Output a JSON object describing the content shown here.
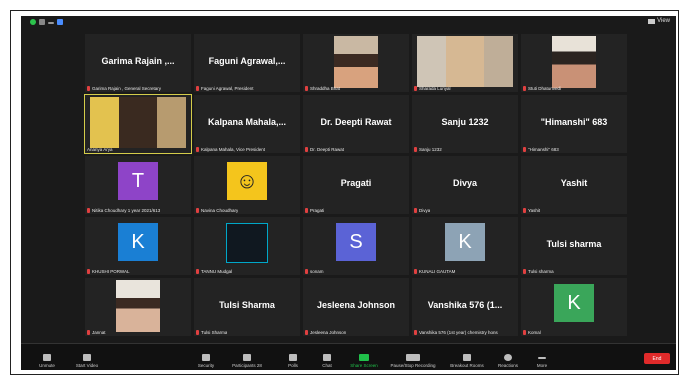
{
  "topbar": {
    "view_label": "View"
  },
  "tiles": [
    {
      "kind": "name",
      "big": "Garima Rajain ,...",
      "label": "Garima Rajain , General Secretary"
    },
    {
      "kind": "name",
      "big": "Faguni Agrawal,...",
      "label": "Faguni Agrawal, President"
    },
    {
      "kind": "photo",
      "label": "Shraddha Bhat"
    },
    {
      "kind": "photo",
      "label": "Sharada Lunyal"
    },
    {
      "kind": "photo",
      "label": "Stuti Dhatunvedi"
    },
    {
      "kind": "photo",
      "label": "Ananya Arya"
    },
    {
      "kind": "name",
      "big": "Kalpana Mahala,...",
      "label": "Kalpana Mahala, Vice President"
    },
    {
      "kind": "name",
      "big": "Dr. Deepti Rawat",
      "label": "Dr. Deepti Rawat"
    },
    {
      "kind": "name",
      "big": "Sanju 1232",
      "label": "Sanju 1232"
    },
    {
      "kind": "name",
      "big": "\"Himanshi\" 683",
      "label": "\"Himanshi\" 683"
    },
    {
      "kind": "avatar",
      "letter": "T",
      "color": "#8e44c8",
      "label": "Nitika Choudhary 1 year 2021/613"
    },
    {
      "kind": "smiley",
      "label": "Navina Choudhary"
    },
    {
      "kind": "name",
      "big": "Pragati",
      "label": "Pragati"
    },
    {
      "kind": "name",
      "big": "Divya",
      "label": "Divya"
    },
    {
      "kind": "name",
      "big": "Yashit",
      "label": "Yashit"
    },
    {
      "kind": "avatar",
      "letter": "K",
      "color": "#1a7fd4",
      "label": "KHUSHI PORWAL"
    },
    {
      "kind": "logo",
      "label": "TANNU Mudgal"
    },
    {
      "kind": "avatar",
      "letter": "S",
      "color": "#5b63d6",
      "label": "sonam"
    },
    {
      "kind": "avatar",
      "letter": "K",
      "color": "#8da3b5",
      "label": "KUNALI GAUTAM"
    },
    {
      "kind": "name",
      "big": "Tulsi sharma",
      "label": "Tulsi sharma"
    },
    {
      "kind": "photo",
      "label": "Jannat"
    },
    {
      "kind": "name",
      "big": "Tulsi Sharma",
      "label": "Tulsi Sharma"
    },
    {
      "kind": "name",
      "big": "Jesleena Johnson",
      "label": "Jesleena Johnson"
    },
    {
      "kind": "name",
      "big": "Vanshika 576 (1...",
      "label": "Vanshika 576 (1st year) chemistry hons"
    },
    {
      "kind": "avatar",
      "letter": "K",
      "color": "#3aa65a",
      "label": "Komal"
    }
  ],
  "toolbar": {
    "unmute": "Unmute",
    "start_video": "Start Video",
    "security": "Security",
    "participants": "Participants",
    "participants_count": "28",
    "polls": "Polls",
    "chat": "Chat",
    "share_screen": "Share Screen",
    "recording": "Pause/Stop Recording",
    "breakout": "Breakout Rooms",
    "reactions": "Reactions",
    "more": "More",
    "end": "End"
  }
}
